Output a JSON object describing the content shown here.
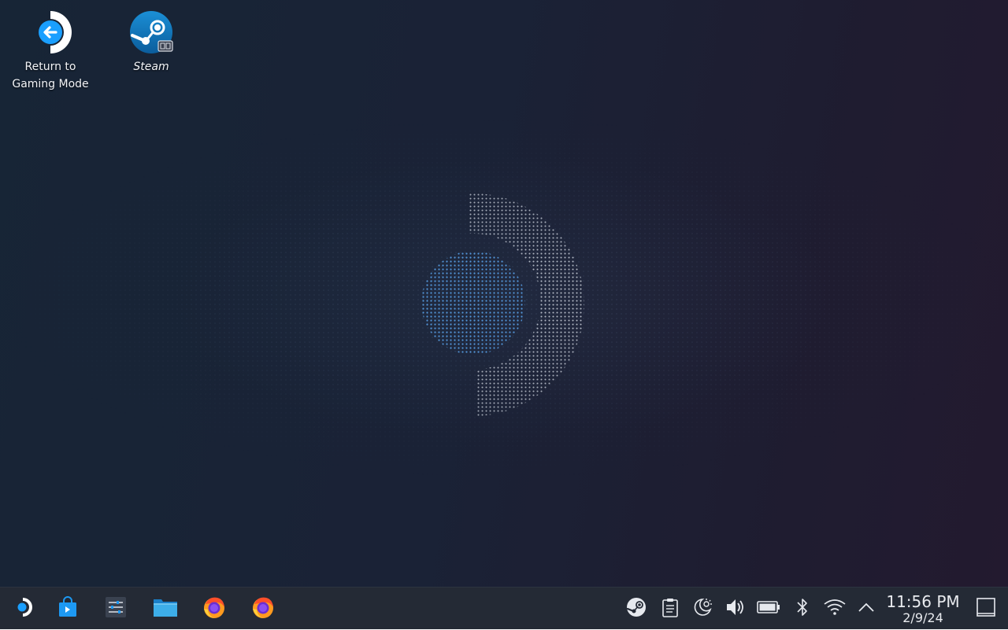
{
  "desktop": {
    "icons": [
      {
        "label": "Return to\nGaming Mode",
        "icon": "return-to-gaming-mode-icon"
      },
      {
        "label": "Steam",
        "icon": "steam-icon"
      }
    ]
  },
  "taskbar": {
    "launcher_icon": "steamos-logo-icon",
    "pinned": [
      {
        "name": "discover",
        "icon": "store-bag-icon"
      },
      {
        "name": "system-settings",
        "icon": "settings-sliders-icon"
      },
      {
        "name": "file-manager",
        "icon": "folder-icon"
      },
      {
        "name": "firefox",
        "icon": "firefox-icon"
      },
      {
        "name": "firefox",
        "icon": "firefox-icon"
      }
    ],
    "tray": [
      {
        "name": "steam",
        "icon": "steam-tray-icon"
      },
      {
        "name": "clipboard",
        "icon": "clipboard-icon"
      },
      {
        "name": "night-light",
        "icon": "night-light-icon"
      },
      {
        "name": "volume",
        "icon": "speaker-icon"
      },
      {
        "name": "battery",
        "icon": "battery-icon"
      },
      {
        "name": "bluetooth",
        "icon": "bluetooth-icon"
      },
      {
        "name": "wifi",
        "icon": "wifi-icon"
      },
      {
        "name": "show-hidden",
        "icon": "chevron-up-icon"
      }
    ],
    "clock": {
      "time": "11:56 PM",
      "date": "2/9/24"
    },
    "show_desktop_icon": "show-desktop-icon"
  },
  "colors": {
    "accent": "#1a9fff",
    "taskbar_bg": "#242a35",
    "desktop_bg": "#1a2236"
  }
}
